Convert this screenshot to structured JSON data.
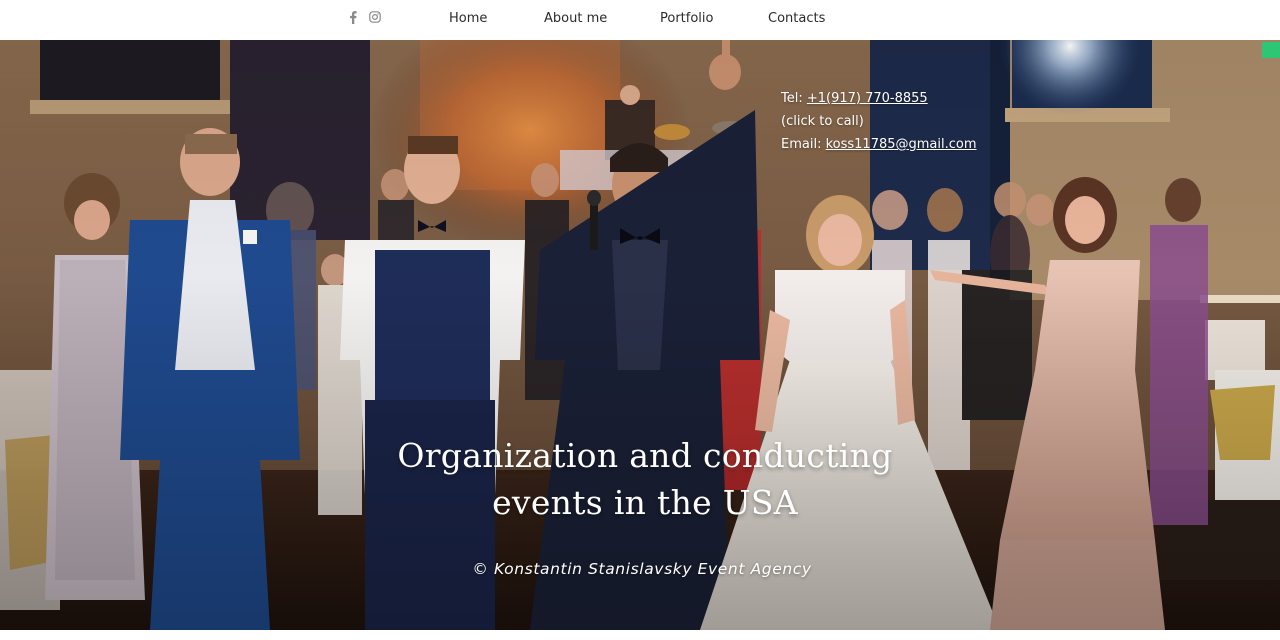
{
  "header": {
    "social": [
      {
        "name": "facebook-icon"
      },
      {
        "name": "instagram-icon"
      }
    ],
    "nav": [
      {
        "label": "Home"
      },
      {
        "label": "About me"
      },
      {
        "label": "Portfolio"
      },
      {
        "label": "Contacts"
      }
    ]
  },
  "hero": {
    "contact": {
      "tel_prefix": "Tel: ",
      "tel_number": "+1(917) 770-8855",
      "tel_note": "(click to call)",
      "email_prefix": "Email: ",
      "email_address": "koss11785@gmail.com"
    },
    "title_line1": "Organization and conducting",
    "title_line2": "events in the USA",
    "credit": "© Konstantin Stanislavsky Event Agency",
    "photo_icon": "wedding-party-photo"
  },
  "colors": {
    "nav_text": "#2b2b2b",
    "social_icon": "#8a8a8a",
    "hero_text": "#ffffff"
  }
}
